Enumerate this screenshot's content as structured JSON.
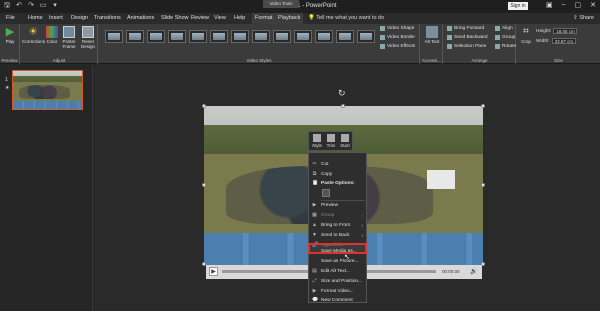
{
  "titlebar": {
    "title": "Presentation1 - PowerPoint",
    "context_tab_group": "Video Tools",
    "sign_in": "Sign in"
  },
  "tabs": [
    "File",
    "Home",
    "Insert",
    "Design",
    "Transitions",
    "Animations",
    "Slide Show",
    "Review",
    "View",
    "Help",
    "Format",
    "Playback"
  ],
  "tell_me": "Tell me what you want to do",
  "share": "Share",
  "ribbon": {
    "preview": {
      "play": "Play",
      "group": "Preview"
    },
    "adjust": {
      "corrections": "Corrections",
      "color": "Color",
      "poster_frame": "Poster Frame",
      "reset_design": "Reset Design",
      "group": "Adjust"
    },
    "video_styles": {
      "group": "Video Styles",
      "shape": "Video Shape",
      "border": "Video Border",
      "effects": "Video Effects"
    },
    "accessibility": {
      "alt_text": "Alt Text",
      "group": "Accessi..."
    },
    "arrange": {
      "bring_forward": "Bring Forward",
      "send_backward": "Send Backward",
      "selection_pane": "Selection Pane",
      "align": "Align",
      "group_btn": "Group",
      "rotate": "Rotate",
      "group": "Arrange"
    },
    "size": {
      "crop": "Crop",
      "height_label": "Height:",
      "height_value": "18.05 cm",
      "width_label": "Width:",
      "width_value": "33.87 cm",
      "group": "Size"
    }
  },
  "slides": {
    "number": "1",
    "star": "★"
  },
  "video_controls": {
    "time": "00:00.00"
  },
  "mini_toolbar": {
    "style": "Style",
    "trim": "Trim",
    "start": "Start"
  },
  "context_menu": {
    "cut": "Cut",
    "copy": "Copy",
    "paste_options": "Paste Options:",
    "preview": "Preview",
    "group": "Group",
    "bring_to_front": "Bring to Front",
    "send_to_back": "Send to Back",
    "hyperlink": "Hyperlink...",
    "save_media_as": "Save Media as...",
    "save_as_picture": "Save as Picture...",
    "edit_alt_text": "Edit Alt Text...",
    "size_and_position": "Size and Position...",
    "format_video": "Format Video...",
    "new_comment": "New Comment"
  },
  "colors": {
    "accent": "#d35a2a",
    "highlight": "#e03030",
    "ribbon": "#3b3b3b"
  }
}
